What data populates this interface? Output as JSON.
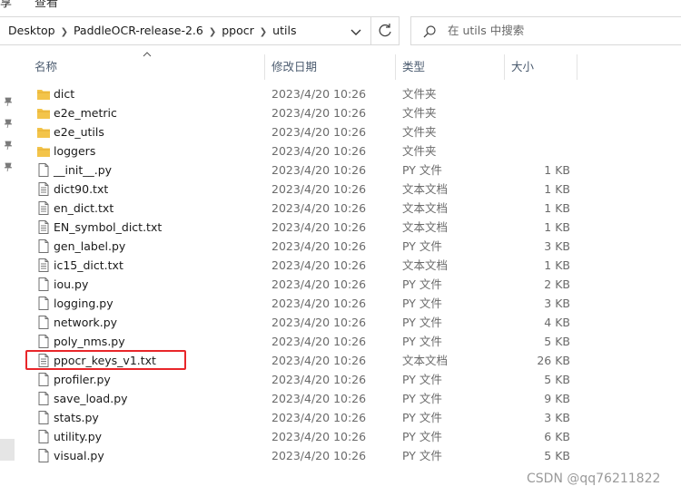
{
  "menu": {
    "left_glyph": "享",
    "view_label": "查看"
  },
  "breadcrumb": [
    "Desktop",
    "PaddleOCR-release-2.6",
    "ppocr",
    "utils"
  ],
  "search": {
    "placeholder": "在 utils 中搜索"
  },
  "columns": {
    "name": "名称",
    "date": "修改日期",
    "type": "类型",
    "size": "大小"
  },
  "files": [
    {
      "name": "dict",
      "date": "2023/4/20 10:26",
      "type": "文件夹",
      "size": "",
      "icon": "folder"
    },
    {
      "name": "e2e_metric",
      "date": "2023/4/20 10:26",
      "type": "文件夹",
      "size": "",
      "icon": "folder"
    },
    {
      "name": "e2e_utils",
      "date": "2023/4/20 10:26",
      "type": "文件夹",
      "size": "",
      "icon": "folder"
    },
    {
      "name": "loggers",
      "date": "2023/4/20 10:26",
      "type": "文件夹",
      "size": "",
      "icon": "folder"
    },
    {
      "name": "__init__.py",
      "date": "2023/4/20 10:26",
      "type": "PY 文件",
      "size": "1 KB",
      "icon": "file"
    },
    {
      "name": "dict90.txt",
      "date": "2023/4/20 10:26",
      "type": "文本文档",
      "size": "1 KB",
      "icon": "text"
    },
    {
      "name": "en_dict.txt",
      "date": "2023/4/20 10:26",
      "type": "文本文档",
      "size": "1 KB",
      "icon": "text"
    },
    {
      "name": "EN_symbol_dict.txt",
      "date": "2023/4/20 10:26",
      "type": "文本文档",
      "size": "1 KB",
      "icon": "text"
    },
    {
      "name": "gen_label.py",
      "date": "2023/4/20 10:26",
      "type": "PY 文件",
      "size": "3 KB",
      "icon": "file"
    },
    {
      "name": "ic15_dict.txt",
      "date": "2023/4/20 10:26",
      "type": "文本文档",
      "size": "1 KB",
      "icon": "text"
    },
    {
      "name": "iou.py",
      "date": "2023/4/20 10:26",
      "type": "PY 文件",
      "size": "2 KB",
      "icon": "file"
    },
    {
      "name": "logging.py",
      "date": "2023/4/20 10:26",
      "type": "PY 文件",
      "size": "3 KB",
      "icon": "file"
    },
    {
      "name": "network.py",
      "date": "2023/4/20 10:26",
      "type": "PY 文件",
      "size": "4 KB",
      "icon": "file"
    },
    {
      "name": "poly_nms.py",
      "date": "2023/4/20 10:26",
      "type": "PY 文件",
      "size": "5 KB",
      "icon": "file"
    },
    {
      "name": "ppocr_keys_v1.txt",
      "date": "2023/4/20 10:26",
      "type": "文本文档",
      "size": "26 KB",
      "icon": "text",
      "highlighted": true
    },
    {
      "name": "profiler.py",
      "date": "2023/4/20 10:26",
      "type": "PY 文件",
      "size": "5 KB",
      "icon": "file"
    },
    {
      "name": "save_load.py",
      "date": "2023/4/20 10:26",
      "type": "PY 文件",
      "size": "9 KB",
      "icon": "file"
    },
    {
      "name": "stats.py",
      "date": "2023/4/20 10:26",
      "type": "PY 文件",
      "size": "3 KB",
      "icon": "file"
    },
    {
      "name": "utility.py",
      "date": "2023/4/20 10:26",
      "type": "PY 文件",
      "size": "6 KB",
      "icon": "file"
    },
    {
      "name": "visual.py",
      "date": "2023/4/20 10:26",
      "type": "PY 文件",
      "size": "5 KB",
      "icon": "file"
    }
  ],
  "highlight_color": "#e8262a",
  "folder_color": "#f3c44a",
  "watermark": "CSDN @qq76211822"
}
